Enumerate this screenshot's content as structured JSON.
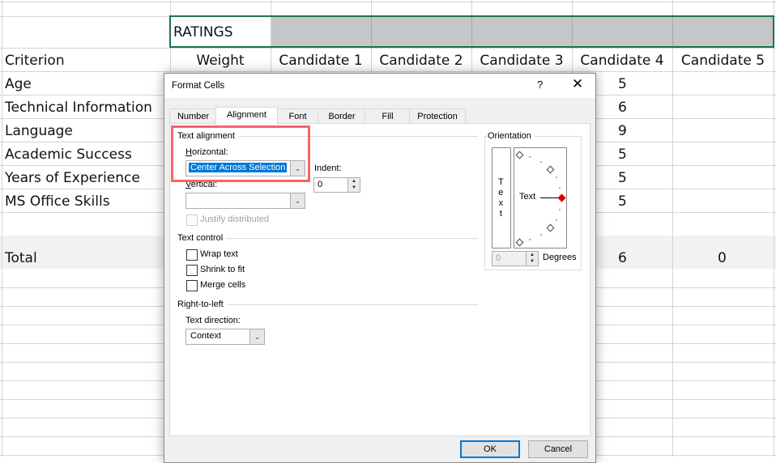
{
  "sheet": {
    "title_cell": "RATINGS",
    "headers": [
      "Criterion",
      "Weight",
      "Candidate 1",
      "Candidate 2",
      "Candidate 3",
      "Candidate 4",
      "Candidate 5"
    ],
    "criteria": [
      "Age",
      "Technical Information",
      "Language",
      "Academic Success",
      "Years of Experience",
      "MS Office Skills"
    ],
    "candidate4_values": [
      "5",
      "6",
      "9",
      "5",
      "5",
      "5"
    ],
    "total_label": "Total",
    "total_candidate4": "6",
    "total_candidate5": "0",
    "selection_color": "#217346"
  },
  "dialog": {
    "title": "Format Cells",
    "help": "?",
    "close": "✕",
    "tabs": [
      "Number",
      "Alignment",
      "Font",
      "Border",
      "Fill",
      "Protection"
    ],
    "active_tab": "Alignment",
    "text_alignment": {
      "group": "Text alignment",
      "horizontal_label": "Horizontal:",
      "horizontal_value": "Center Across Selection",
      "indent_label": "Indent:",
      "indent_value": "0",
      "vertical_label": "Vertical:",
      "vertical_value": "",
      "justify_distributed": "Justify distributed"
    },
    "text_control": {
      "group": "Text control",
      "wrap": "Wrap text",
      "shrink": "Shrink to fit",
      "merge": "Merge cells"
    },
    "rtl": {
      "group": "Right-to-left",
      "direction_label": "Text direction:",
      "direction_value": "Context"
    },
    "orientation": {
      "group": "Orientation",
      "vertical_text": [
        "T",
        "e",
        "x",
        "t"
      ],
      "dial_text": "Text",
      "degrees_value": "0",
      "degrees_label": "Degrees"
    },
    "ok": "OK",
    "cancel": "Cancel",
    "highlight_color": "#f2666a"
  }
}
